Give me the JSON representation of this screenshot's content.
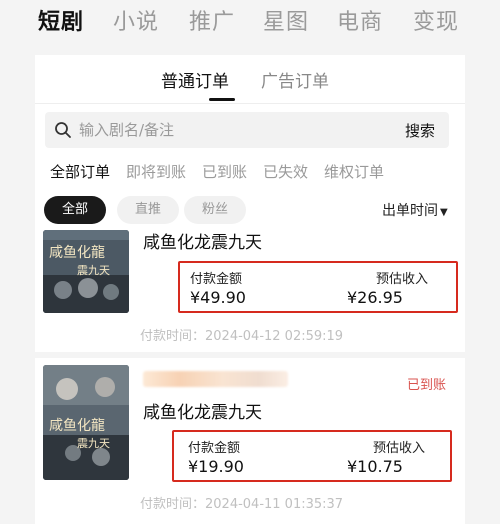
{
  "top_tabs": [
    "短剧",
    "小说",
    "推广",
    "星图",
    "电商",
    "变现"
  ],
  "sub_tabs": [
    "普通订单",
    "广告订单"
  ],
  "search": {
    "placeholder": "输入剧名/备注",
    "button": "搜索",
    "icon": "search-icon"
  },
  "filter_tabs": [
    "全部订单",
    "即将到账",
    "已到账",
    "已失效",
    "维权订单"
  ],
  "pills": [
    "全部",
    "直推",
    "粉丝"
  ],
  "sort": {
    "label": "出单时间",
    "icon": "caret-down-icon"
  },
  "orders": [
    {
      "title": "咸鱼化龙震九天",
      "cover_text": "咸鱼化龍",
      "cover_sub": "震九天",
      "pay_label": "付款金额",
      "pay_value": "¥49.90",
      "est_label": "预估收入",
      "est_value": "¥26.95",
      "time": "付款时间：2024-04-12 02:59:19"
    },
    {
      "title": "咸鱼化龙震九天",
      "cover_text": "咸鱼化龍",
      "cover_sub": "震九天",
      "status": "已到账",
      "pay_label": "付款金额",
      "pay_value": "¥19.90",
      "est_label": "预估收入",
      "est_value": "¥10.75",
      "time": "付款时间：2024-04-11 01:35:37"
    }
  ],
  "colors": {
    "highlight_border": "#d62a1e",
    "status": "#d9534f",
    "pill_active": "#1a1a1a"
  }
}
